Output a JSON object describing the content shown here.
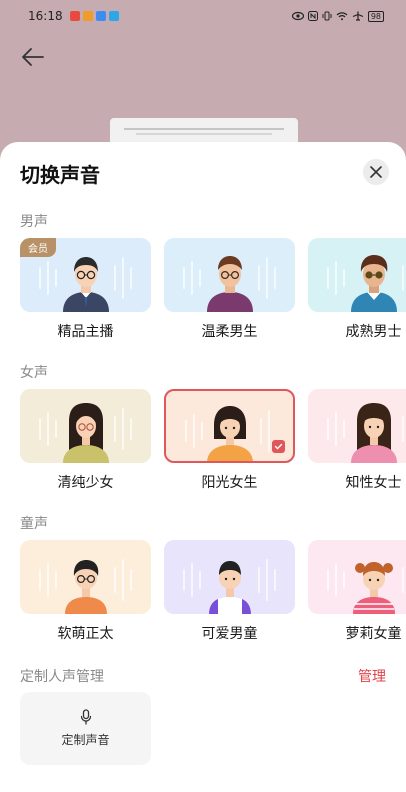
{
  "status_bar": {
    "time": "16:18",
    "battery": "98"
  },
  "sheet": {
    "title": "切换声音",
    "sections": [
      {
        "label": "男声",
        "voices": [
          {
            "name": "精品主播",
            "badge": "会员",
            "bg": "#dcecfa",
            "selected": false
          },
          {
            "name": "温柔男生",
            "bg": "#dbeefa",
            "selected": false
          },
          {
            "name": "成熟男士",
            "bg": "#d6f2f4",
            "selected": false
          }
        ]
      },
      {
        "label": "女声",
        "voices": [
          {
            "name": "清纯少女",
            "bg": "#f3ecd9",
            "selected": false
          },
          {
            "name": "阳光女生",
            "bg": "#fde8dc",
            "selected": true
          },
          {
            "name": "知性女士",
            "bg": "#fde8ec",
            "selected": false
          }
        ]
      },
      {
        "label": "童声",
        "voices": [
          {
            "name": "软萌正太",
            "bg": "#fdeedc",
            "selected": false
          },
          {
            "name": "可爱男童",
            "bg": "#e7e4fb",
            "selected": false
          },
          {
            "name": "萝莉女童",
            "bg": "#fde8f2",
            "selected": false
          }
        ]
      }
    ],
    "custom": {
      "label": "定制人声管理",
      "manage": "管理",
      "button_label": "定制声音"
    }
  },
  "colors": {
    "accent": "#e0434a",
    "backdrop": "#c6abb0"
  }
}
